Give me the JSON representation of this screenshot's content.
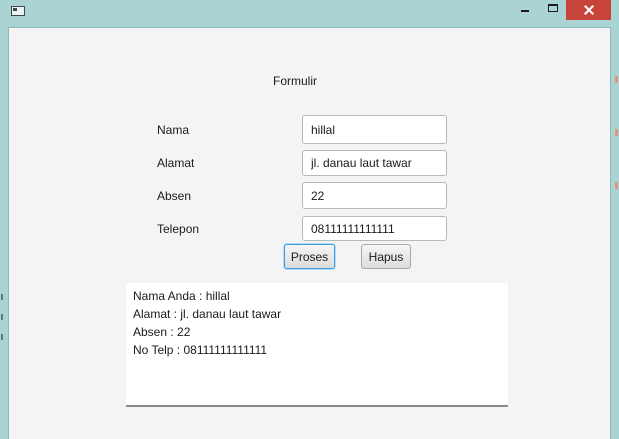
{
  "window": {
    "icon": "app-window-icon",
    "controls": {
      "minimize": "minimize-icon",
      "maximize": "maximize-icon",
      "close": "close-icon"
    }
  },
  "form": {
    "title": "Formulir",
    "fields": [
      {
        "label": "Nama",
        "value": "hillal"
      },
      {
        "label": "Alamat",
        "value": "jl. danau laut tawar"
      },
      {
        "label": "Absen",
        "value": "22"
      },
      {
        "label": "Telepon",
        "value": "08111111111111"
      }
    ],
    "buttons": {
      "proses": "Proses",
      "hapus": "Hapus"
    }
  },
  "output": {
    "lines": [
      "Nama Anda : hillal",
      "Alamat : jl. danau laut tawar",
      "Absen : 22",
      "No Telp : 08111111111111"
    ]
  },
  "colors": {
    "title_bar": "#aad3d3",
    "close_button": "#c7443b",
    "focus_ring": "#3b9be0",
    "panel": "#f4f4f4"
  }
}
